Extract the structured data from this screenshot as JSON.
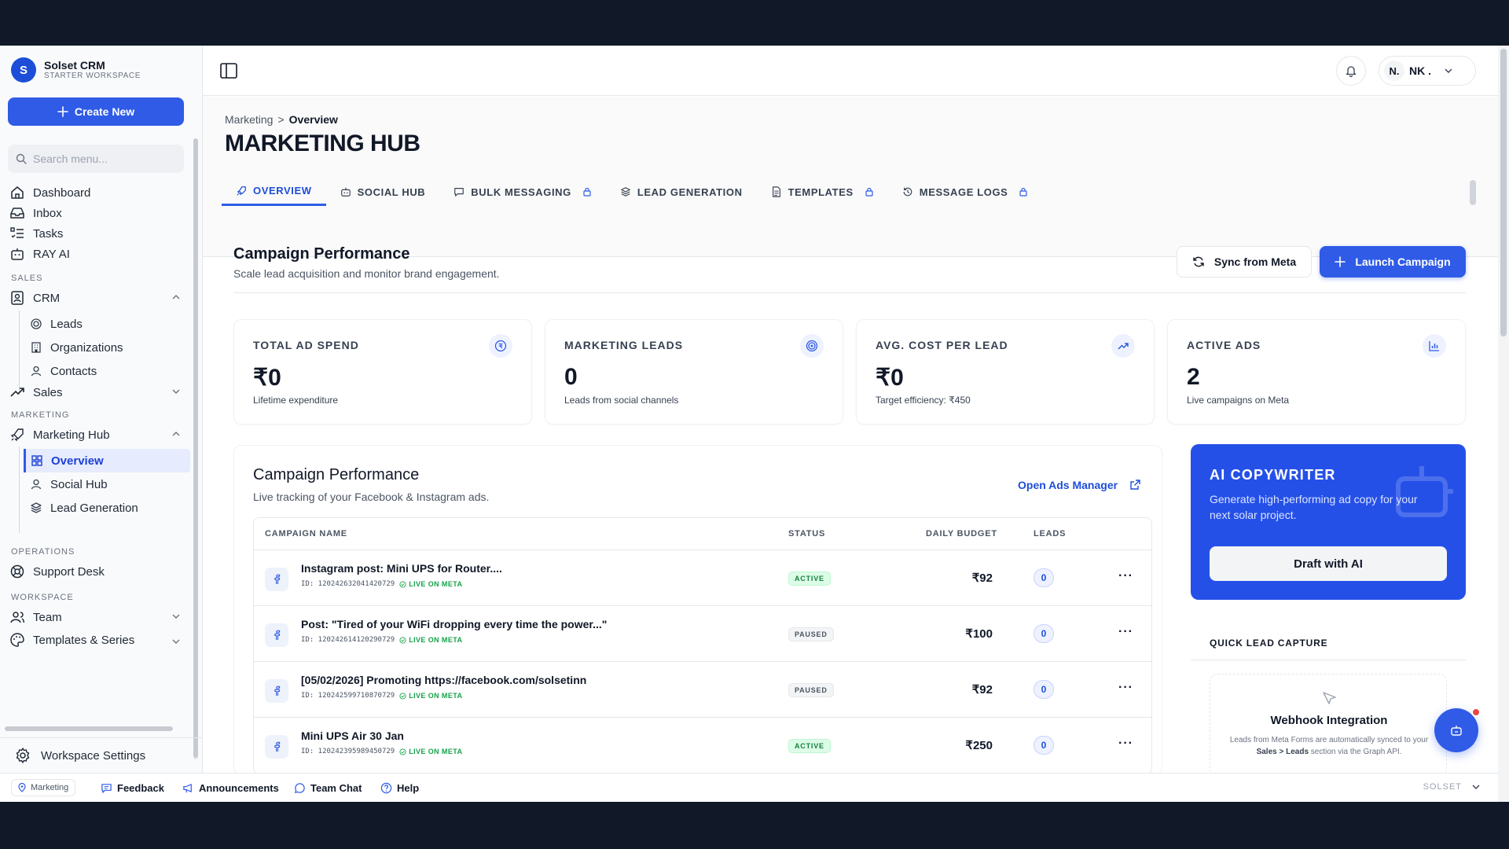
{
  "brand": {
    "name": "Solset CRM",
    "subtitle": "STARTER WORKSPACE",
    "logo_letter": "S"
  },
  "sidebar": {
    "create_label": "Create New",
    "search_placeholder": "Search menu...",
    "items": [
      {
        "label": "Dashboard",
        "icon": "home-icon"
      },
      {
        "label": "Inbox",
        "icon": "inbox-icon"
      },
      {
        "label": "Tasks",
        "icon": "tasks-icon"
      },
      {
        "label": "RAY AI",
        "icon": "bot-icon"
      }
    ],
    "sections": {
      "sales": "SALES",
      "marketing": "MARKETING",
      "operations": "OPERATIONS",
      "workspace": "WORKSPACE"
    },
    "crm": {
      "label": "CRM",
      "children": [
        "Leads",
        "Organizations",
        "Contacts"
      ]
    },
    "sales_label": "Sales",
    "marketing_hub": {
      "label": "Marketing Hub",
      "children": [
        "Overview",
        "Social Hub",
        "Lead Generation"
      ],
      "active": "Overview"
    },
    "support_desk": "Support Desk",
    "team": "Team",
    "templates_series": "Templates & Series",
    "workspace_settings": "Workspace Settings"
  },
  "header": {
    "user_initial": "N.",
    "user_name": "NK ."
  },
  "page": {
    "breadcrumb": {
      "parent": "Marketing",
      "separator": ">",
      "current": "Overview"
    },
    "title": "MARKETING HUB",
    "tabs": [
      {
        "label": "OVERVIEW",
        "icon": "rocket-icon",
        "locked": false,
        "active": true
      },
      {
        "label": "SOCIAL HUB",
        "icon": "bot-icon",
        "locked": false
      },
      {
        "label": "BULK MESSAGING",
        "icon": "message-icon",
        "locked": true
      },
      {
        "label": "LEAD GENERATION",
        "icon": "layers-icon",
        "locked": false
      },
      {
        "label": "TEMPLATES",
        "icon": "file-icon",
        "locked": true
      },
      {
        "label": "MESSAGE LOGS",
        "icon": "history-icon",
        "locked": true
      }
    ]
  },
  "campaign_section": {
    "title": "Campaign Performance",
    "subtitle": "Scale lead acquisition and monitor brand engagement.",
    "sync_label": "Sync from Meta",
    "launch_label": "Launch Campaign"
  },
  "stats": [
    {
      "label": "TOTAL AD SPEND",
      "value": "₹0",
      "note": "Lifetime expenditure",
      "icon": "currency-icon"
    },
    {
      "label": "MARKETING LEADS",
      "value": "0",
      "note": "Leads from social channels",
      "icon": "target-icon"
    },
    {
      "label": "AVG. COST PER LEAD",
      "value": "₹0",
      "note": "Target efficiency: ₹450",
      "icon": "trending-up-icon"
    },
    {
      "label": "ACTIVE ADS",
      "value": "2",
      "note": "Live campaigns on Meta",
      "icon": "bar-chart-icon"
    }
  ],
  "table_card": {
    "title": "Campaign Performance",
    "subtitle": "Live tracking of your Facebook & Instagram ads.",
    "open_ads_label": "Open Ads Manager",
    "columns": [
      "CAMPAIGN NAME",
      "STATUS",
      "DAILY BUDGET",
      "LEADS"
    ],
    "live_label": "LIVE ON META",
    "rows": [
      {
        "name": "Instagram post: Mini UPS for Router....",
        "id": "ID: 120242632041420729",
        "status": "ACTIVE",
        "budget": "₹92",
        "leads": "0"
      },
      {
        "name": "Post: \"Tired of your WiFi dropping every time the power...\"",
        "id": "ID: 120242614120290729",
        "status": "PAUSED",
        "budget": "₹100",
        "leads": "0"
      },
      {
        "name": "[05/02/2026] Promoting https://facebook.com/solsetinn",
        "id": "ID: 120242599710870729",
        "status": "PAUSED",
        "budget": "₹92",
        "leads": "0"
      },
      {
        "name": "Mini UPS Air 30 Jan",
        "id": "ID: 120242395989450729",
        "status": "ACTIVE",
        "budget": "₹250",
        "leads": "0"
      }
    ]
  },
  "ai_copywriter": {
    "title": "AI COPYWRITER",
    "subtitle": "Generate high-performing ad copy for your next solar project.",
    "button": "Draft with AI"
  },
  "quick_lead": {
    "title": "QUICK LEAD CAPTURE",
    "webhook_title": "Webhook Integration",
    "webhook_desc_1": "Leads from Meta Forms are automatically synced to your ",
    "webhook_desc_bold": "Sales > Leads",
    "webhook_desc_2": " section via the Graph API."
  },
  "bottombar": {
    "location": "Marketing",
    "feedback": "Feedback",
    "announcements": "Announcements",
    "team_chat": "Team Chat",
    "help": "Help",
    "brand": "SOLSET"
  },
  "colors": {
    "accent": "#2f5be6",
    "active_green": "#15803d",
    "sidebar_bg": "#f9fafb"
  }
}
